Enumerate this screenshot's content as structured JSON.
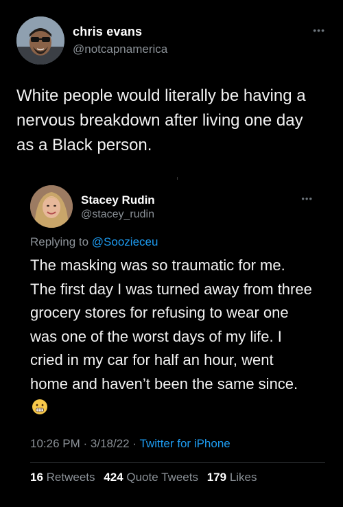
{
  "outer_tweet": {
    "display_name": "chris evans",
    "handle": "@notcapnamerica",
    "more_icon": "more-dots-icon",
    "text": "White people would literally be having a nervous breakdown after living one day as a Black person."
  },
  "quoted_tweet": {
    "display_name": "Stacey Rudin",
    "handle": "@stacey_rudin",
    "more_icon": "more-dots-icon",
    "replying_prefix": "Replying to",
    "replying_mention": "@Soozieceu",
    "text": "The masking was so traumatic for me. The first day I was turned away from three grocery stores for refusing to wear one was one of the worst days of my life. I cried in my car for half an hour, went home and haven’t been the same since.",
    "emoji": "grimacing-face-emoji",
    "time": "10:26 PM",
    "date": "3/18/22",
    "separator": "·",
    "source": "Twitter for iPhone",
    "stats": {
      "retweets_count": "16",
      "retweets_label": "Retweets",
      "quote_tweets_count": "424",
      "quote_tweets_label": "Quote Tweets",
      "likes_count": "179",
      "likes_label": "Likes"
    }
  },
  "colors": {
    "background": "#000000",
    "primary_text": "#f2f2f2",
    "secondary_text": "#8b9197",
    "link_blue": "#1d9bf0"
  }
}
